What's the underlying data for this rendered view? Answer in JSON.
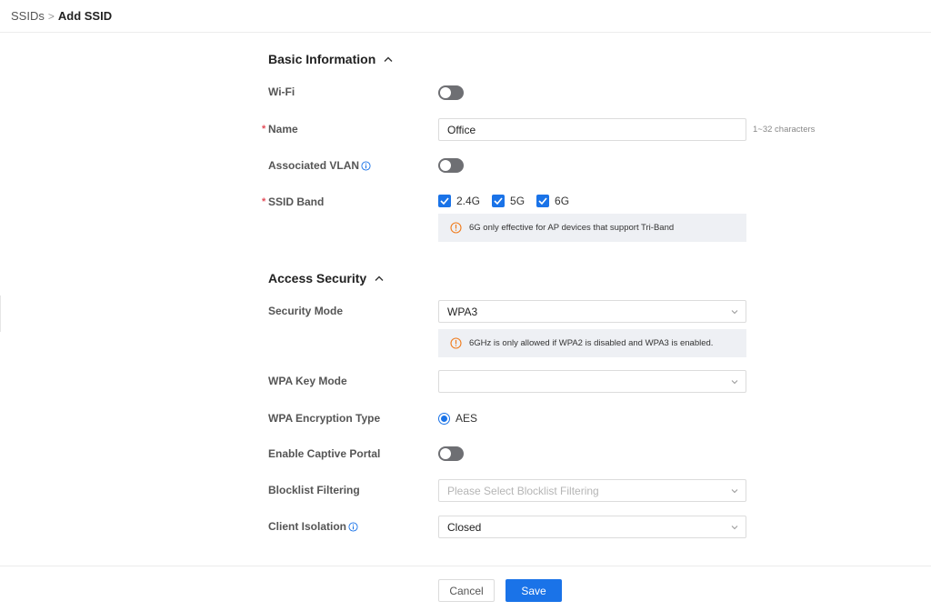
{
  "breadcrumb": {
    "parent": "SSIDs",
    "separator": ">",
    "current": "Add SSID"
  },
  "basic": {
    "title": "Basic Information",
    "wifi_label": "Wi-Fi",
    "name_label": "Name",
    "name_required": "*",
    "name_value": "Office",
    "name_hint": "1~32 characters",
    "vlan_label": "Associated VLAN",
    "band_label": "SSID Band",
    "band_required": "*",
    "bands": [
      "2.4G",
      "5G",
      "6G"
    ],
    "band_notice": "6G only effective for AP devices that support Tri-Band"
  },
  "access": {
    "title": "Access Security",
    "security_mode_label": "Security Mode",
    "security_mode_value": "WPA3",
    "security_notice": "6GHz is only allowed if WPA2 is disabled and WPA3 is enabled.",
    "wpa_key_mode_label": "WPA Key Mode",
    "wpa_key_mode_value": "",
    "encryption_label": "WPA Encryption Type",
    "encryption_value": "AES",
    "captive_label": "Enable Captive Portal",
    "blocklist_label": "Blocklist Filtering",
    "blocklist_placeholder": "Please Select Blocklist Filtering",
    "isolation_label": "Client Isolation",
    "isolation_value": "Closed"
  },
  "footer": {
    "cancel": "Cancel",
    "save": "Save"
  },
  "colors": {
    "accent": "#1a73e8",
    "toggle_off": "#6e6f73",
    "required": "#e34d59",
    "warning": "#f07c1d",
    "notice_bg": "#eef0f4"
  },
  "icons": {
    "section_toggle": "chevron-up-icon",
    "info": "info-icon",
    "warning": "warning-icon",
    "dropdown": "chevron-down-icon",
    "check": "check-icon"
  }
}
